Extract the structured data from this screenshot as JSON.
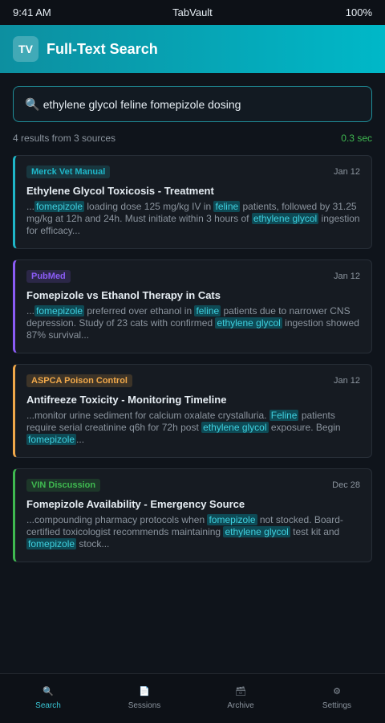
{
  "status": {
    "time": "9:41 AM",
    "app": "TabVault",
    "battery": "100%"
  },
  "header": {
    "logo": "TV",
    "title": "Full-Text Search"
  },
  "search": {
    "value": "ethylene glycol feline fomepizole dosing",
    "icon": "search-icon"
  },
  "meta": {
    "summary": "4 results from 3 sources",
    "elapsed": "0.3 sec"
  },
  "colors": {
    "accent": "#00b8c8",
    "merck": "#1fb6c8",
    "pubmed": "#8b5cf6",
    "aspca": "#f0a84a",
    "vin": "#3fb950"
  },
  "results": [
    {
      "source": "Merck Vet Manual",
      "date": "Jan 12",
      "title": "Ethylene Glycol Toxicosis - Treatment",
      "snippet": [
        {
          "t": "..."
        },
        {
          "h": "fomepizole"
        },
        {
          "t": " loading dose 125 mg/kg IV in "
        },
        {
          "h": "feline"
        },
        {
          "t": " patients, followed by 31.25 mg/kg at 12h and 24h. Must initiate within 3 hours of "
        },
        {
          "h": "ethylene glycol"
        },
        {
          "t": " ingestion for efficacy..."
        }
      ]
    },
    {
      "source": "PubMed",
      "date": "Jan 12",
      "title": "Fomepizole vs Ethanol Therapy in Cats",
      "snippet": [
        {
          "t": "..."
        },
        {
          "h": "fomepizole"
        },
        {
          "t": " preferred over ethanol in "
        },
        {
          "h": "feline"
        },
        {
          "t": " patients due to narrower CNS depression. Study of 23 cats with confirmed "
        },
        {
          "h": "ethylene glycol"
        },
        {
          "t": " ingestion showed 87% survival..."
        }
      ]
    },
    {
      "source": "ASPCA Poison Control",
      "date": "Jan 12",
      "title": "Antifreeze Toxicity - Monitoring Timeline",
      "snippet": [
        {
          "t": "...monitor urine sediment for calcium oxalate crystalluria. "
        },
        {
          "h": "Feline"
        },
        {
          "t": " patients require serial creatinine q6h for 72h post "
        },
        {
          "h": "ethylene glycol"
        },
        {
          "t": " exposure. Begin "
        },
        {
          "h": "fomepizole"
        },
        {
          "t": "..."
        }
      ]
    },
    {
      "source": "VIN Discussion",
      "date": "Dec 28",
      "title": "Fomepizole Availability - Emergency Source",
      "snippet": [
        {
          "t": "...compounding pharmacy protocols when "
        },
        {
          "h": "fomepizole"
        },
        {
          "t": " not stocked. Board-certified toxicologist recommends maintaining "
        },
        {
          "h": "ethylene glycol"
        },
        {
          "t": " test kit and "
        },
        {
          "h": "fomepizole"
        },
        {
          "t": " stock..."
        }
      ]
    }
  ],
  "nav": [
    {
      "label": "Search",
      "icon": "🔍",
      "icon_name": "search-icon"
    },
    {
      "label": "Sessions",
      "icon": "📄",
      "icon_name": "document-icon"
    },
    {
      "label": "Archive",
      "icon": "🗃",
      "icon_name": "archive-icon"
    },
    {
      "label": "Settings",
      "icon": "⚙",
      "icon_name": "gear-icon"
    }
  ]
}
